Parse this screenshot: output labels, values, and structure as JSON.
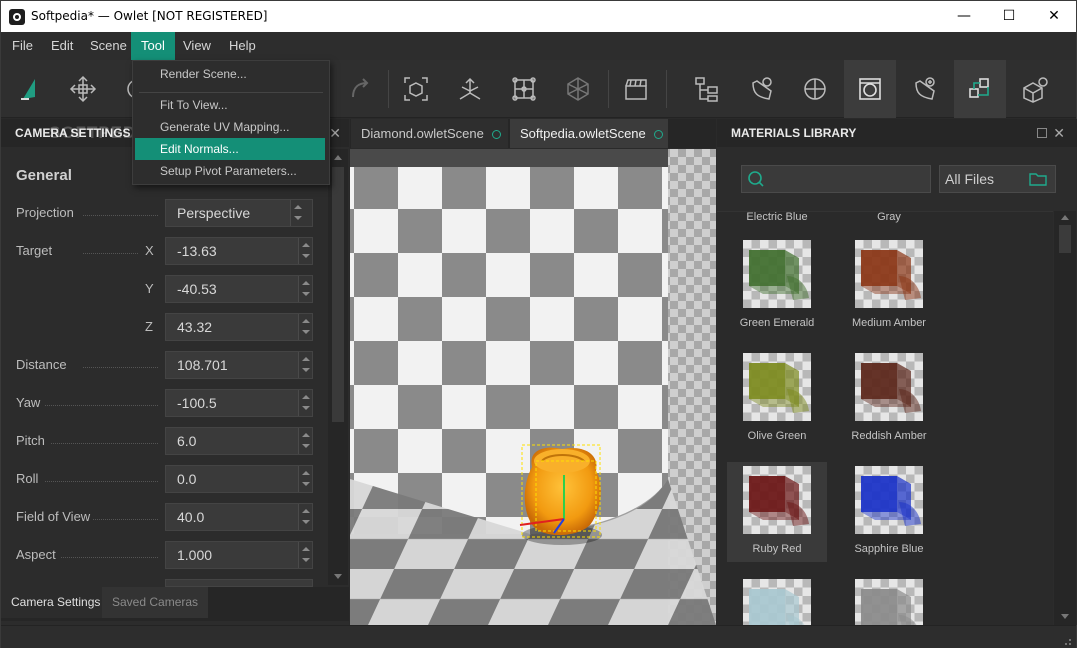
{
  "window": {
    "title": "Softpedia* — Owlet [NOT REGISTERED]",
    "controls": {
      "minimize": "—",
      "maximize": "☐",
      "close": "✕"
    }
  },
  "menu": [
    "File",
    "Edit",
    "Scene",
    "Tool",
    "View",
    "Help"
  ],
  "active_menu": "Tool",
  "tool_menu": {
    "items": [
      "Render Scene...",
      "Fit To View...",
      "Generate UV Mapping...",
      "Edit Normals...",
      "Setup Pivot Parameters..."
    ],
    "highlighted": "Edit Normals..."
  },
  "toolbar_icons": [
    "select-tool-icon",
    "move-tool-icon",
    "rotate-tool-icon",
    "redo-icon",
    "frame-selection-icon",
    "axes-tool-icon",
    "vertex-grid-icon",
    "mesh-tool-icon",
    "clapperboard-icon",
    "hierarchy-icon",
    "light-settings-icon",
    "sphere-icon",
    "camera-panel-icon",
    "light-add-icon",
    "materials-icon",
    "object-settings-icon"
  ],
  "camera_panel": {
    "header": "CAMERA SETTINGS",
    "close": "✕",
    "section": "General",
    "projection_label": "Projection",
    "projection_value": "Perspective",
    "target_label": "Target",
    "target": {
      "x_label": "X",
      "x": "-13.63",
      "y_label": "Y",
      "y": "-40.53",
      "z_label": "Z",
      "z": "43.32"
    },
    "properties": [
      {
        "label": "Distance",
        "value": "108.701"
      },
      {
        "label": "Yaw",
        "value": "-100.5"
      },
      {
        "label": "Pitch",
        "value": "6.0"
      },
      {
        "label": "Roll",
        "value": "0.0"
      },
      {
        "label": "Field of View",
        "value": "40.0"
      },
      {
        "label": "Aspect",
        "value": "1.000"
      }
    ],
    "tabs": [
      "Camera Settings",
      "Saved Cameras"
    ],
    "active_tab": "Camera Settings"
  },
  "viewport": {
    "tabs": [
      "Diamond.owletScene",
      "Softpedia.owletScene"
    ],
    "active_tab": "Softpedia.owletScene"
  },
  "materials": {
    "header": "MATERIALS LIBRARY",
    "search_value": "",
    "filter": "All Files",
    "partial_labels": [
      "Electric Blue",
      "Gray"
    ],
    "items": [
      {
        "label": "Green Emerald",
        "color": "#3f6e2c"
      },
      {
        "label": "Medium Amber",
        "color": "#8a3414"
      },
      {
        "label": "Olive Green",
        "color": "#7c8a1c"
      },
      {
        "label": "Reddish Amber",
        "color": "#5a2418"
      },
      {
        "label": "Ruby Red",
        "color": "#6a1414"
      },
      {
        "label": "Sapphire Blue",
        "color": "#1830c8"
      },
      {
        "label": "",
        "color": "#a8c8d0"
      },
      {
        "label": "",
        "color": "#8a8a8a"
      }
    ],
    "selected": "Ruby Red"
  },
  "watermark": "SOFTPEDIA",
  "colors": {
    "accent": "#148f77",
    "ring": "#1faa8c"
  }
}
